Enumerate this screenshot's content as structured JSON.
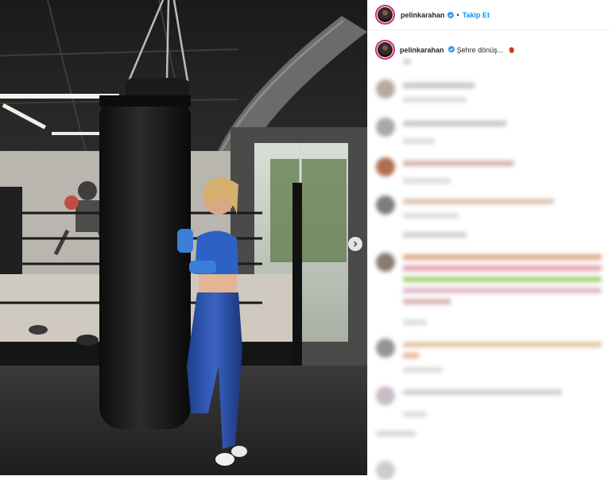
{
  "post": {
    "username": "pelinkarahan",
    "follow_label": "Takip Et",
    "separator": "•",
    "caption_user": "pelinkarahan",
    "caption_text": "Şehre dönüş..."
  },
  "icons": {
    "verified": "verified-badge-icon",
    "next": "chevron-right-icon",
    "boxing_glove": "boxing-glove-emoji"
  },
  "colors": {
    "link": "#0095f6",
    "text": "#262626",
    "verified": "#3897f0",
    "story_ring": "#d62976"
  }
}
